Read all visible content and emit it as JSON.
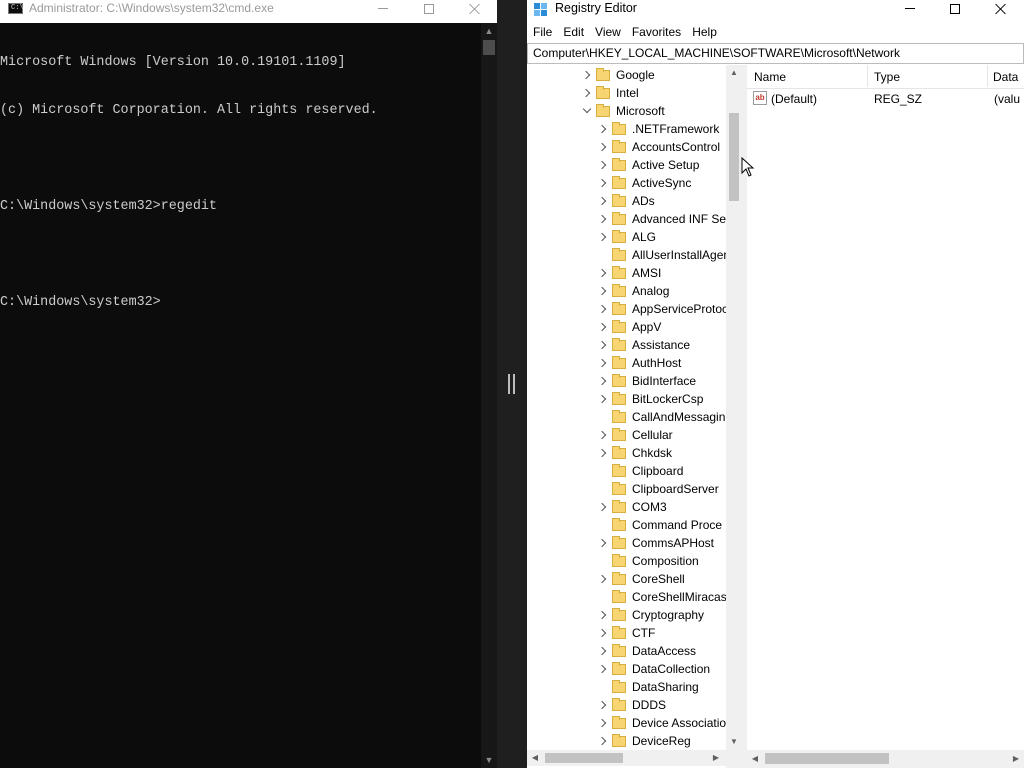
{
  "cmd": {
    "title": "Administrator: C:\\Windows\\system32\\cmd.exe",
    "icon_label": "C:\\",
    "lines": [
      "Microsoft Windows [Version 10.0.19101.1109]",
      "(c) Microsoft Corporation. All rights reserved.",
      "",
      "C:\\Windows\\system32>regedit",
      "",
      "C:\\Windows\\system32>"
    ]
  },
  "regedit": {
    "title": "Registry Editor",
    "menu": [
      "File",
      "Edit",
      "View",
      "Favorites",
      "Help"
    ],
    "address": "Computer\\HKEY_LOCAL_MACHINE\\SOFTWARE\\Microsoft\\Network",
    "tree": {
      "top_nodes": [
        {
          "label": "Google",
          "expander": "collapsed"
        },
        {
          "label": "Intel",
          "expander": "collapsed"
        },
        {
          "label": "Microsoft",
          "expander": "expanded"
        }
      ],
      "children": [
        {
          "label": ".NETFramework",
          "expander": "collapsed"
        },
        {
          "label": "AccountsControl",
          "expander": "collapsed"
        },
        {
          "label": "Active Setup",
          "expander": "collapsed"
        },
        {
          "label": "ActiveSync",
          "expander": "collapsed"
        },
        {
          "label": "ADs",
          "expander": "collapsed"
        },
        {
          "label": "Advanced INF Set",
          "expander": "collapsed"
        },
        {
          "label": "ALG",
          "expander": "collapsed"
        },
        {
          "label": "AllUserInstallAger",
          "expander": "none"
        },
        {
          "label": "AMSI",
          "expander": "collapsed"
        },
        {
          "label": "Analog",
          "expander": "collapsed"
        },
        {
          "label": "AppServiceProtoc",
          "expander": "collapsed"
        },
        {
          "label": "AppV",
          "expander": "collapsed"
        },
        {
          "label": "Assistance",
          "expander": "collapsed"
        },
        {
          "label": "AuthHost",
          "expander": "collapsed"
        },
        {
          "label": "BidInterface",
          "expander": "collapsed"
        },
        {
          "label": "BitLockerCsp",
          "expander": "collapsed"
        },
        {
          "label": "CallAndMessagin",
          "expander": "none"
        },
        {
          "label": "Cellular",
          "expander": "collapsed"
        },
        {
          "label": "Chkdsk",
          "expander": "collapsed"
        },
        {
          "label": "Clipboard",
          "expander": "none"
        },
        {
          "label": "ClipboardServer",
          "expander": "none"
        },
        {
          "label": "COM3",
          "expander": "collapsed"
        },
        {
          "label": "Command Proce",
          "expander": "none"
        },
        {
          "label": "CommsAPHost",
          "expander": "collapsed"
        },
        {
          "label": "Composition",
          "expander": "none"
        },
        {
          "label": "CoreShell",
          "expander": "collapsed"
        },
        {
          "label": "CoreShellMiracas",
          "expander": "none"
        },
        {
          "label": "Cryptography",
          "expander": "collapsed"
        },
        {
          "label": "CTF",
          "expander": "collapsed"
        },
        {
          "label": "DataAccess",
          "expander": "collapsed"
        },
        {
          "label": "DataCollection",
          "expander": "collapsed"
        },
        {
          "label": "DataSharing",
          "expander": "none"
        },
        {
          "label": "DDDS",
          "expander": "collapsed"
        },
        {
          "label": "Device Associatio",
          "expander": "collapsed"
        },
        {
          "label": "DeviceReg",
          "expander": "collapsed"
        }
      ]
    },
    "values": {
      "columns": [
        "Name",
        "Type",
        "Data"
      ],
      "rows": [
        {
          "name": "(Default)",
          "type": "REG_SZ",
          "data": "(valu"
        }
      ]
    },
    "colors": {
      "folder": "#f7d573",
      "icon_blue": "#2a8bd6"
    }
  }
}
